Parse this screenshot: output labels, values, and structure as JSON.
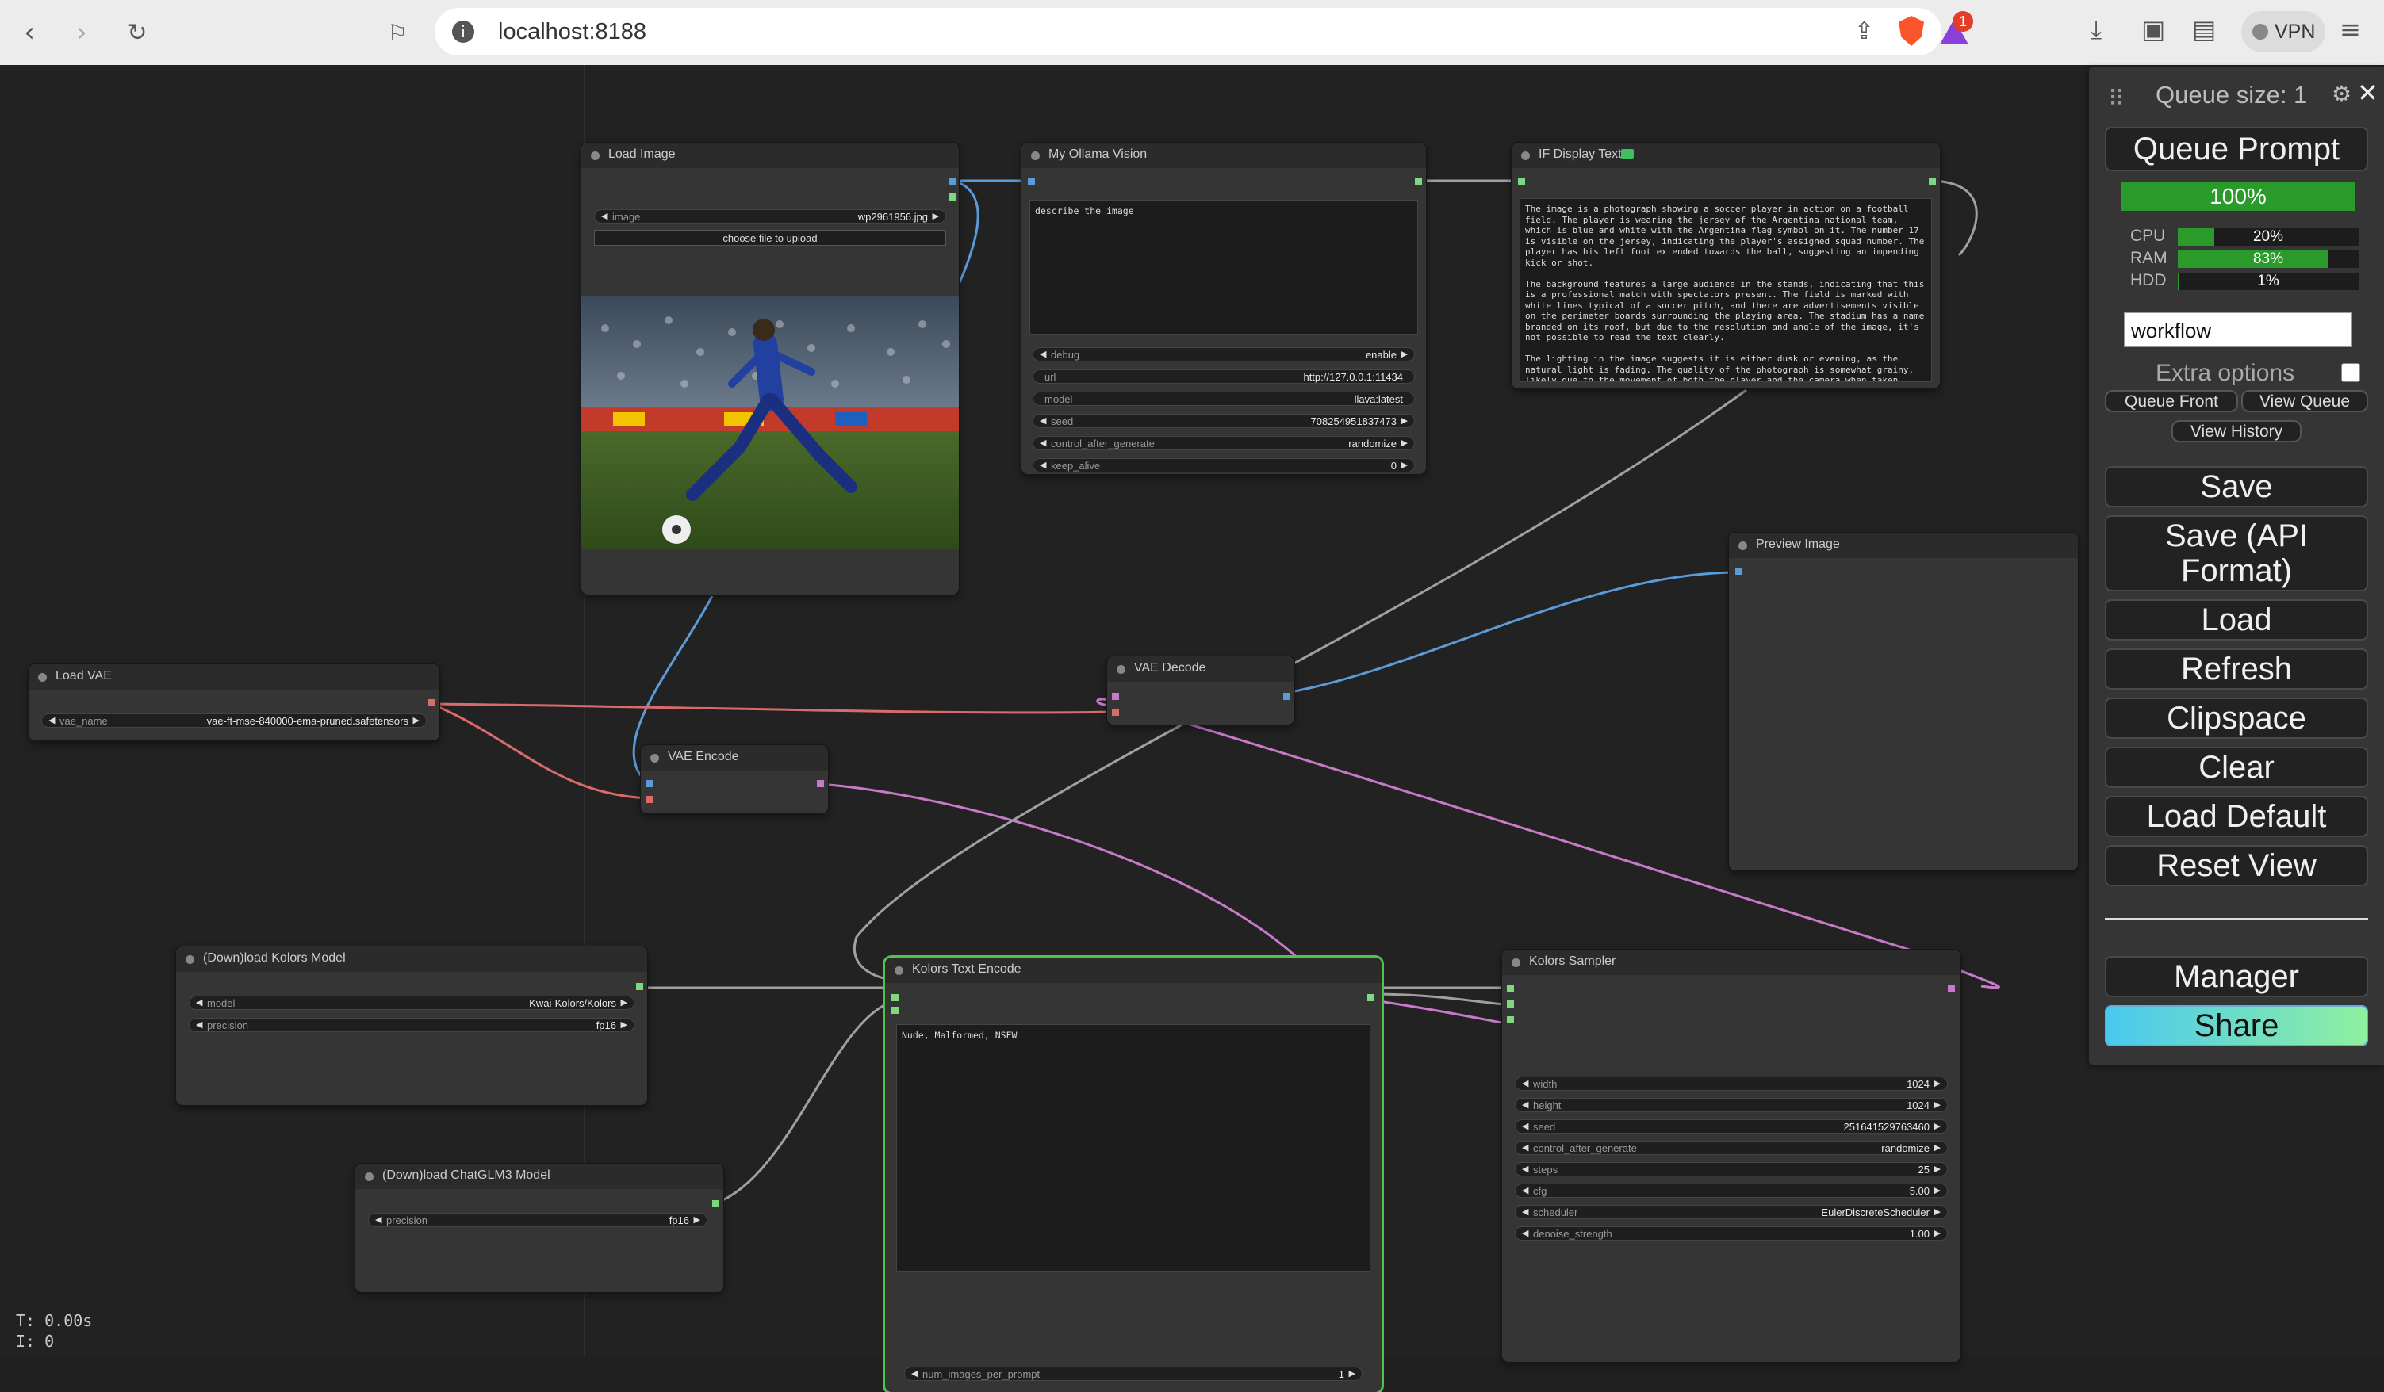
{
  "browser": {
    "url": "localhost:8188",
    "rewards_badge": "1",
    "vpn_label": "VPN",
    "icons": [
      "back-icon",
      "forward-icon",
      "reload-icon",
      "bookmark-icon",
      "info-icon",
      "share-icon",
      "brave-shields-icon",
      "brave-rewards-icon",
      "download-icon",
      "sidebar-icon",
      "wallet-icon",
      "menu-icon"
    ]
  },
  "nodes": {
    "load_image": {
      "title": "Load Image",
      "image_label": "image",
      "image_value": "wp2961956.jpg",
      "upload_label": "choose file to upload"
    },
    "ollama": {
      "title": "My Ollama Vision",
      "prompt": "describe the image",
      "widgets": [
        {
          "label": "debug",
          "value": "enable"
        },
        {
          "label": "url",
          "value": "http://127.0.0.1:11434"
        },
        {
          "label": "model",
          "value": "llava:latest"
        },
        {
          "label": "seed",
          "value": "708254951837473"
        },
        {
          "label": "control_after_generate",
          "value": "randomize"
        },
        {
          "label": "keep_alive",
          "value": "0"
        }
      ]
    },
    "display_text": {
      "title": "IF Display Text",
      "text": "The image is a photograph showing a soccer player in action on a football field. The player is wearing the jersey of the Argentina national team, which is blue and white with the Argentina flag symbol on it. The number 17 is visible on the jersey, indicating the player's assigned squad number. The player has his left foot extended towards the ball, suggesting an impending kick or shot.\n\nThe background features a large audience in the stands, indicating that this is a professional match with spectators present. The field is marked with white lines typical of a soccer pitch, and there are advertisements visible on the perimeter boards surrounding the playing area. The stadium has a name branded on its roof, but due to the resolution and angle of the image, it's not possible to read the text clearly.\n\nThe lighting in the image suggests it is either dusk or evening, as the natural light is fading. The quality of the photograph is somewhat grainy, likely due to the movement of both the player and the camera when taken."
    },
    "preview_image": {
      "title": "Preview Image"
    },
    "load_vae": {
      "title": "Load VAE",
      "widget": {
        "label": "vae_name",
        "value": "vae-ft-mse-840000-ema-pruned.safetensors"
      }
    },
    "vae_decode": {
      "title": "VAE Decode"
    },
    "vae_encode": {
      "title": "VAE Encode"
    },
    "kolors_model": {
      "title": "(Down)load Kolors Model",
      "widgets": [
        {
          "label": "model",
          "value": "Kwai-Kolors/Kolors"
        },
        {
          "label": "precision",
          "value": "fp16"
        }
      ]
    },
    "chatglm": {
      "title": "(Down)load ChatGLM3 Model",
      "widget": {
        "label": "precision",
        "value": "fp16"
      }
    },
    "text_encode": {
      "title": "Kolors Text Encode",
      "prompt": "Nude, Malformed, NSFW",
      "widget": {
        "label": "num_images_per_prompt",
        "value": "1"
      }
    },
    "sampler": {
      "title": "Kolors Sampler",
      "widgets": [
        {
          "label": "width",
          "value": "1024"
        },
        {
          "label": "height",
          "value": "1024"
        },
        {
          "label": "seed",
          "value": "251641529763460"
        },
        {
          "label": "control_after_generate",
          "value": "randomize"
        },
        {
          "label": "steps",
          "value": "25"
        },
        {
          "label": "cfg",
          "value": "5.00"
        },
        {
          "label": "scheduler",
          "value": "EulerDiscreteScheduler"
        },
        {
          "label": "denoise_strength",
          "value": "1.00"
        }
      ]
    }
  },
  "stats": {
    "time": "T: 0.00s",
    "iter": "I: 0"
  },
  "panel": {
    "queue_size": "Queue size: 1",
    "queue_prompt": "Queue Prompt",
    "progress": "100%",
    "progress_value": 100,
    "meters": [
      {
        "label": "CPU",
        "value": "20%",
        "fill": 20
      },
      {
        "label": "RAM",
        "value": "83%",
        "fill": 83
      },
      {
        "label": "HDD",
        "value": "1%",
        "fill": 1
      }
    ],
    "workflow_name": "workflow",
    "extra_options": "Extra options",
    "queue_front": "Queue Front",
    "view_queue": "View Queue",
    "view_history": "View History",
    "save": "Save",
    "save_api": "Save (API Format)",
    "load": "Load",
    "refresh": "Refresh",
    "clipspace": "Clipspace",
    "clear": "Clear",
    "load_default": "Load Default",
    "reset_view": "Reset View",
    "manager": "Manager",
    "share": "Share"
  }
}
